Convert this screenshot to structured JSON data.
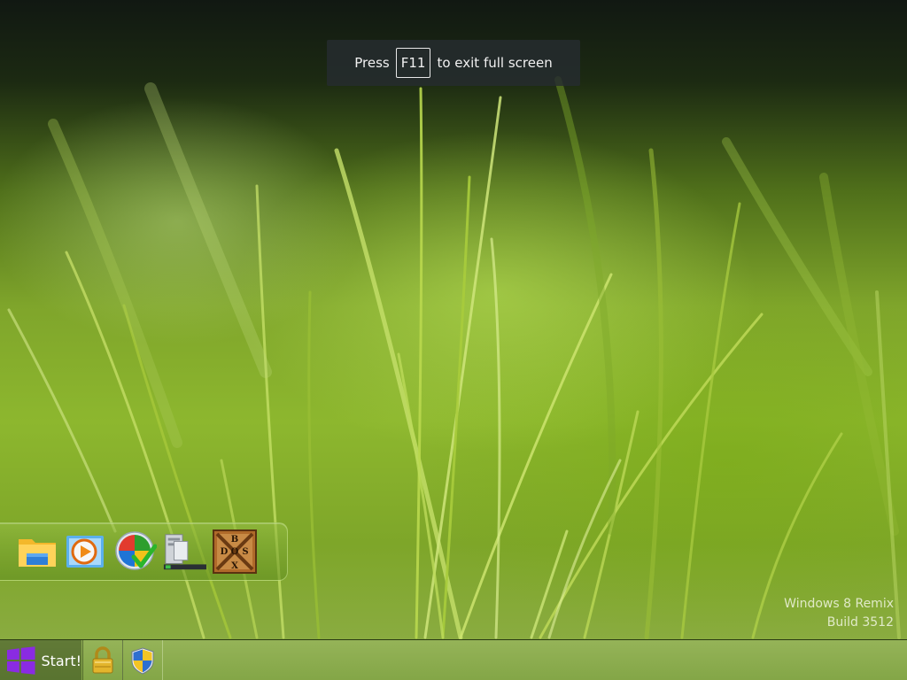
{
  "fullscreen_hint": {
    "prefix": "Press",
    "key": "F11",
    "suffix": "to exit full screen"
  },
  "dock": {
    "items": [
      {
        "icon": "file-explorer-icon"
      },
      {
        "icon": "media-player-icon"
      },
      {
        "icon": "windows-update-icon"
      },
      {
        "icon": "computer-icon"
      },
      {
        "icon": "dosbox-icon",
        "text": "DOSBOX"
      }
    ]
  },
  "watermark": {
    "line1": "Windows 8 Remix",
    "line2": "Build 3512"
  },
  "taskbar": {
    "start_label": "Start!",
    "buttons": [
      {
        "icon": "lock-icon"
      },
      {
        "icon": "shield-icon"
      }
    ]
  },
  "colors": {
    "start_logo": "#8a2be2",
    "taskbar": "#96b45a"
  }
}
